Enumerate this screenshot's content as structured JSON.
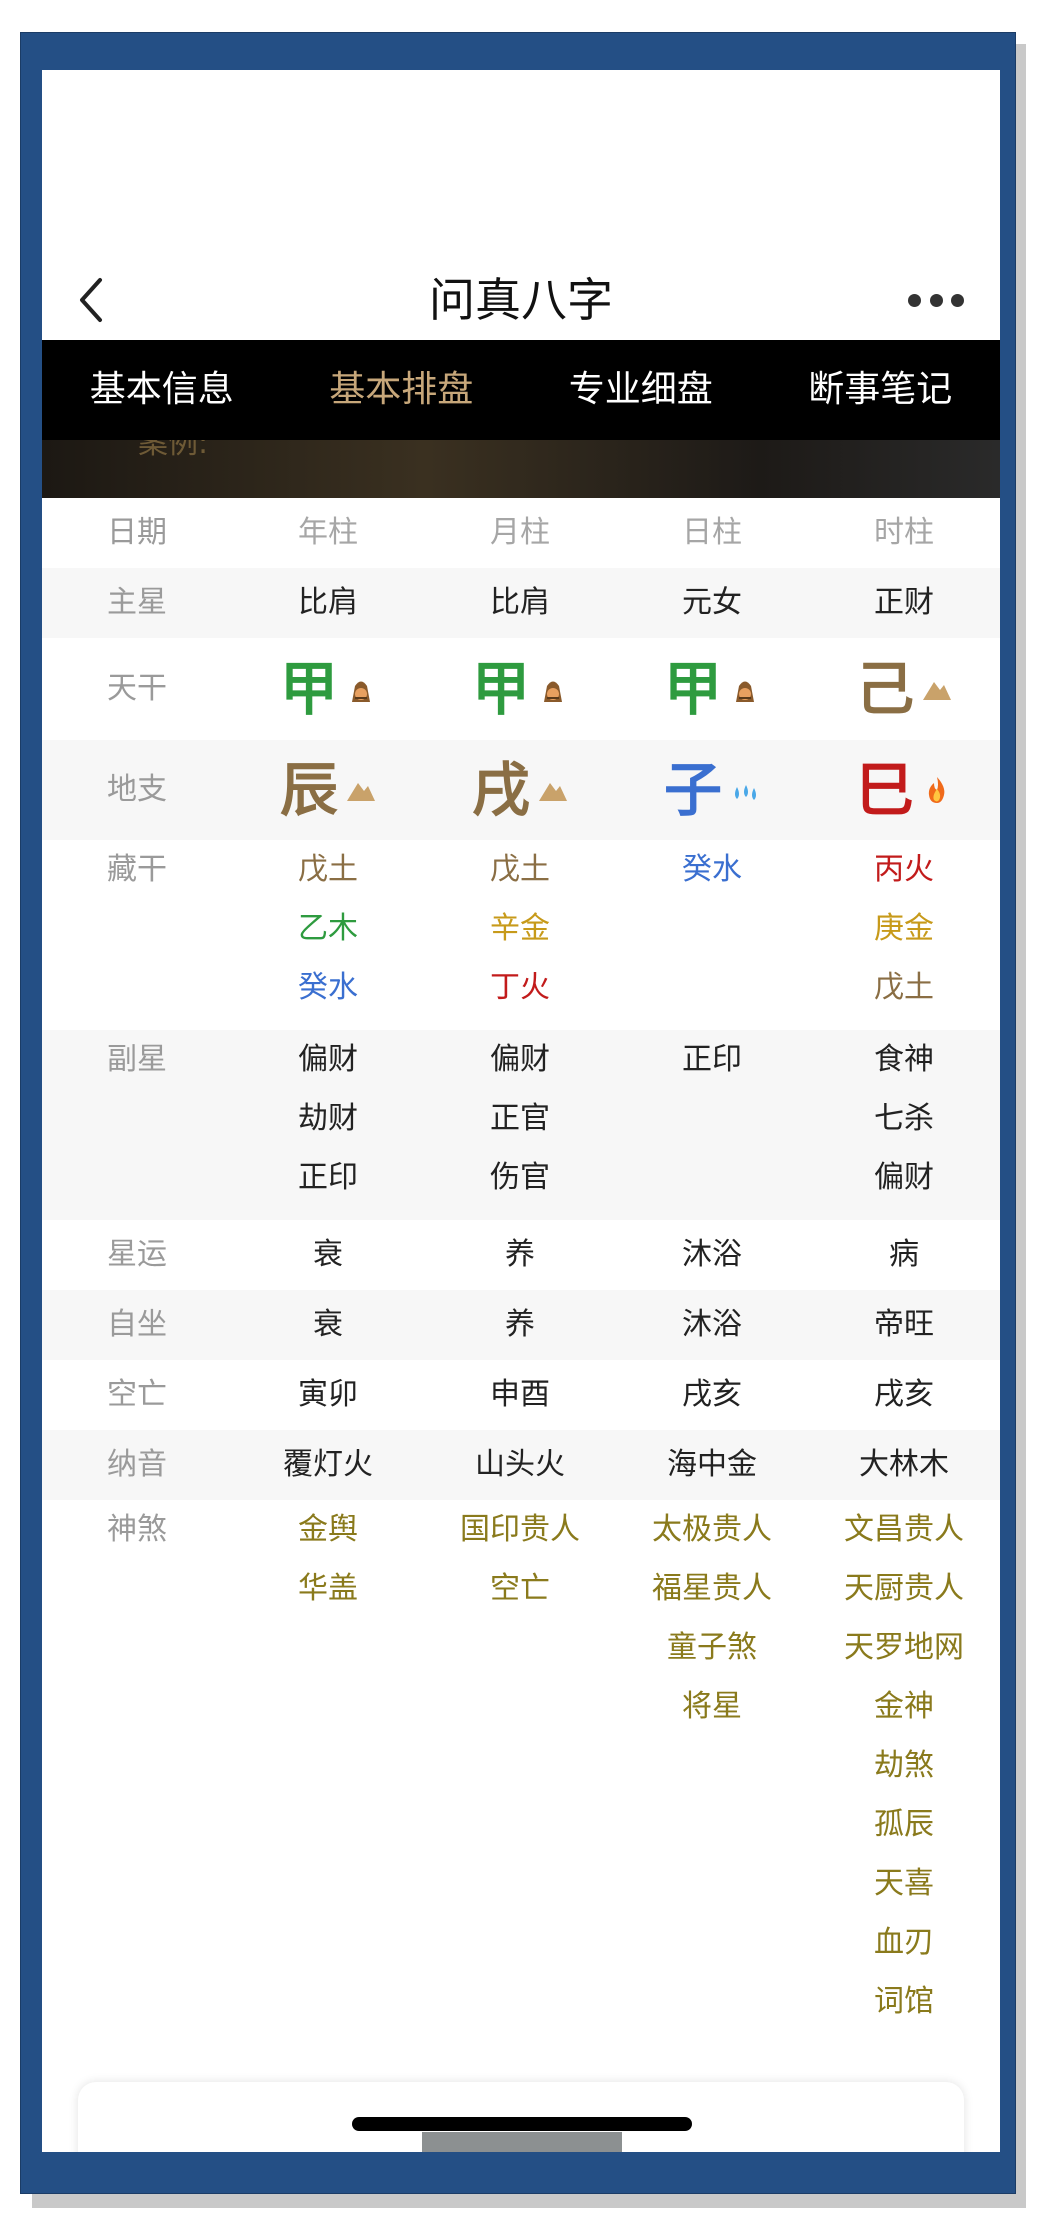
{
  "nav": {
    "title": "问真八字"
  },
  "tabs": [
    {
      "label": "基本信息",
      "active": false
    },
    {
      "label": "基本排盘",
      "active": true
    },
    {
      "label": "专业细盘",
      "active": false
    },
    {
      "label": "断事笔记",
      "active": false
    }
  ],
  "banner": {
    "text": "案例:"
  },
  "colors": {
    "wood": "#2e9b3f",
    "earth": "#8a6e44",
    "water": "#3a6fd0",
    "fire": "#c21b1b",
    "metal": "#c79a1a",
    "shensha": "#8a7a1c"
  },
  "grid": {
    "header": {
      "label": "日期",
      "cols": [
        "年柱",
        "月柱",
        "日柱",
        "时柱"
      ]
    },
    "main_star": {
      "label": "主星",
      "cols": [
        "比肩",
        "比肩",
        "元女",
        "正财"
      ]
    },
    "tiangan": {
      "label": "天干",
      "cols": [
        "甲",
        "甲",
        "甲",
        "己"
      ],
      "icons": [
        "wood-icon",
        "wood-icon",
        "wood-icon",
        "earth-icon"
      ]
    },
    "dizhi": {
      "label": "地支",
      "cols": [
        "辰",
        "戌",
        "子",
        "巳"
      ],
      "icons": [
        "earth-icon",
        "earth-icon",
        "water-icon",
        "fire-icon"
      ]
    },
    "canggan": {
      "label": "藏干",
      "cols": [
        [
          "戊土",
          "乙木",
          "癸水"
        ],
        [
          "戊土",
          "辛金",
          "丁火"
        ],
        [
          "癸水"
        ],
        [
          "丙火",
          "庚金",
          "戊土"
        ]
      ]
    },
    "fuxing": {
      "label": "副星",
      "cols": [
        [
          "偏财",
          "劫财",
          "正印"
        ],
        [
          "偏财",
          "正官",
          "伤官"
        ],
        [
          "正印"
        ],
        [
          "食神",
          "七杀",
          "偏财"
        ]
      ]
    },
    "xingyun": {
      "label": "星运",
      "cols": [
        "衰",
        "养",
        "沐浴",
        "病"
      ]
    },
    "zizuo": {
      "label": "自坐",
      "cols": [
        "衰",
        "养",
        "沐浴",
        "帝旺"
      ]
    },
    "kongwang": {
      "label": "空亡",
      "cols": [
        "寅卯",
        "申酉",
        "戌亥",
        "戌亥"
      ]
    },
    "nayin": {
      "label": "纳音",
      "cols": [
        "覆灯火",
        "山头火",
        "海中金",
        "大林木"
      ]
    },
    "shensha": {
      "label": "神煞",
      "cols": [
        [
          "金舆",
          "华盖"
        ],
        [
          "国印贵人",
          "空亡"
        ],
        [
          "太极贵人",
          "福星贵人",
          "童子煞",
          "将星"
        ],
        [
          "文昌贵人",
          "天厨贵人",
          "天罗地网",
          "金神",
          "劫煞",
          "孤辰",
          "天喜",
          "血刃",
          "词馆"
        ]
      ]
    }
  }
}
